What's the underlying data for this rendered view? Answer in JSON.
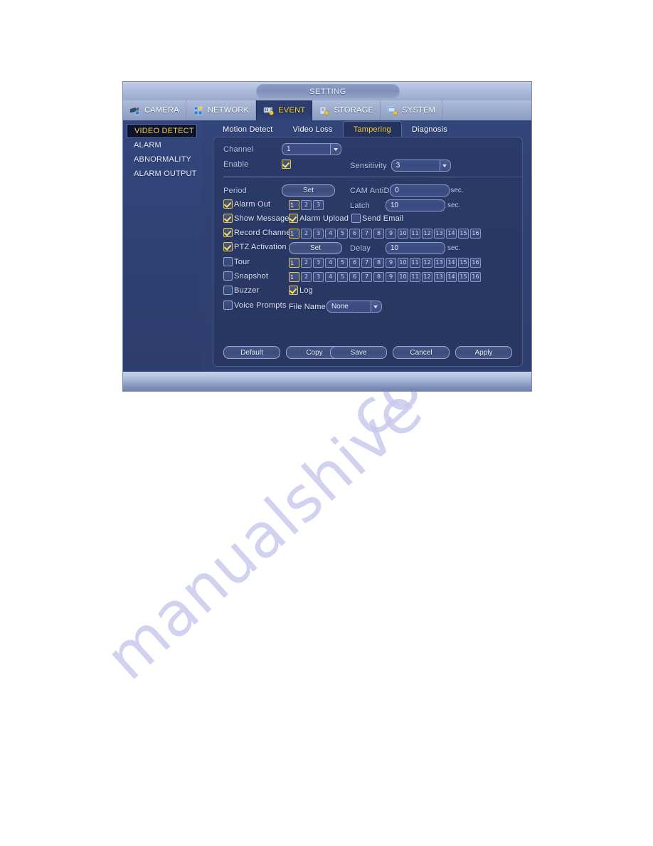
{
  "watermark": {
    "line1": "manualshive",
    "line2": "com"
  },
  "window": {
    "title": "SETTING"
  },
  "main_nav": [
    {
      "label": "CAMERA",
      "icon": "camera-icon",
      "active": false
    },
    {
      "label": "NETWORK",
      "icon": "network-icon",
      "active": false
    },
    {
      "label": "EVENT",
      "icon": "event-icon",
      "active": true
    },
    {
      "label": "STORAGE",
      "icon": "storage-icon",
      "active": false
    },
    {
      "label": "SYSTEM",
      "icon": "system-icon",
      "active": false
    }
  ],
  "sidebar": {
    "items": [
      {
        "label": "VIDEO DETECT",
        "active": true
      },
      {
        "label": "ALARM",
        "active": false
      },
      {
        "label": "ABNORMALITY",
        "active": false
      },
      {
        "label": "ALARM OUTPUT",
        "active": false
      }
    ]
  },
  "tabs": [
    {
      "label": "Motion Detect",
      "active": false
    },
    {
      "label": "Video Loss",
      "active": false
    },
    {
      "label": "Tampering",
      "active": true
    },
    {
      "label": "Diagnosis",
      "active": false
    }
  ],
  "form": {
    "channel": {
      "label": "Channel",
      "value": "1"
    },
    "enable": {
      "label": "Enable",
      "checked": true
    },
    "sensitivity": {
      "label": "Sensitivity",
      "value": "3"
    },
    "period": {
      "label": "Period",
      "button": "Set"
    },
    "cam_antidither": {
      "label": "CAM AntiDi",
      "value": "0",
      "unit": "sec."
    },
    "alarm_out": {
      "label": "Alarm Out",
      "checked": true,
      "channels": [
        "1",
        "2",
        "3"
      ],
      "selected": [
        "1"
      ]
    },
    "latch": {
      "label": "Latch",
      "value": "10",
      "unit": "sec."
    },
    "show_message": {
      "label": "Show Message",
      "checked": true
    },
    "alarm_upload": {
      "label": "Alarm Upload",
      "checked": true
    },
    "send_email": {
      "label": "Send Email",
      "checked": false
    },
    "record_channel": {
      "label": "Record Channel",
      "checked": true,
      "channels": [
        "1",
        "2",
        "3",
        "4",
        "5",
        "6",
        "7",
        "8",
        "9",
        "10",
        "11",
        "12",
        "13",
        "14",
        "15",
        "16"
      ],
      "selected": [
        "1"
      ]
    },
    "ptz_activation": {
      "label": "PTZ Activation",
      "checked": true,
      "button": "Set"
    },
    "delay": {
      "label": "Delay",
      "value": "10",
      "unit": "sec."
    },
    "tour": {
      "label": "Tour",
      "checked": false,
      "channels": [
        "1",
        "2",
        "3",
        "4",
        "5",
        "6",
        "7",
        "8",
        "9",
        "10",
        "11",
        "12",
        "13",
        "14",
        "15",
        "16"
      ],
      "selected": [
        "1"
      ]
    },
    "snapshot": {
      "label": "Snapshot",
      "checked": false,
      "channels": [
        "1",
        "2",
        "3",
        "4",
        "5",
        "6",
        "7",
        "8",
        "9",
        "10",
        "11",
        "12",
        "13",
        "14",
        "15",
        "16"
      ],
      "selected": [
        "1"
      ]
    },
    "buzzer": {
      "label": "Buzzer",
      "checked": false
    },
    "log": {
      "label": "Log",
      "checked": true
    },
    "voice_prompts": {
      "label": "Voice Prompts",
      "checked": false
    },
    "file_name": {
      "label": "File Name",
      "value": "None"
    }
  },
  "footer": {
    "default_label": "Default",
    "copy_label": "Copy",
    "save_label": "Save",
    "cancel_label": "Cancel",
    "apply_label": "Apply"
  },
  "colors": {
    "accent_yellow": "#ffd23a",
    "panel_bg": "#2a3965",
    "window_blue": "#8ea1c7",
    "label_blue": "#b9c4e4"
  }
}
